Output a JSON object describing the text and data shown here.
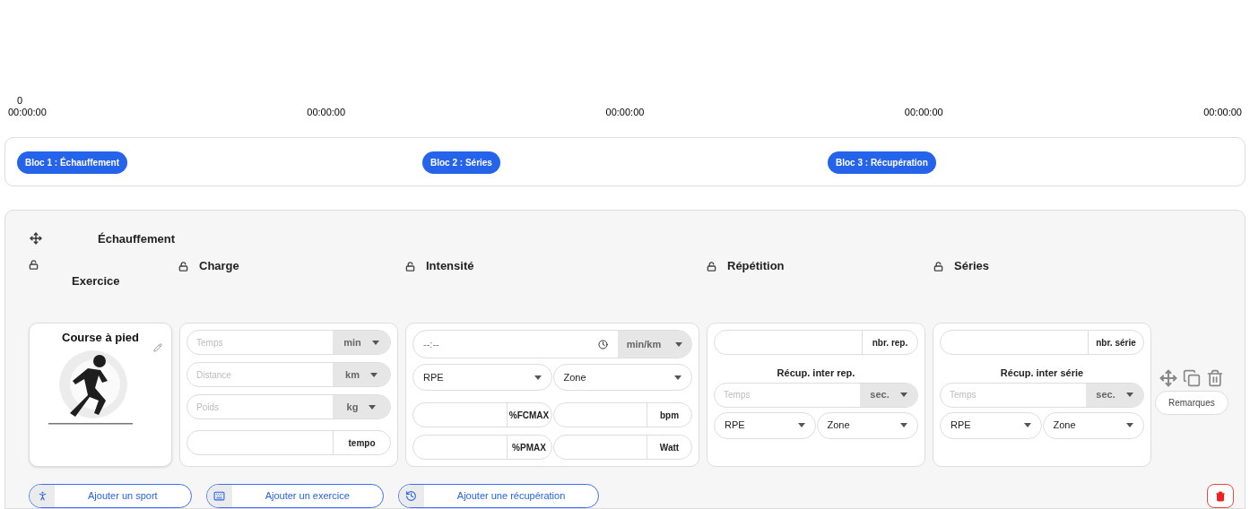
{
  "timeline": {
    "origin": "0",
    "marks": [
      "00:00:00",
      "00:00:00",
      "00:00:00",
      "00:00:00",
      "00:00:00"
    ]
  },
  "blocks": [
    {
      "label": "Bloc 1 : Échauffement"
    },
    {
      "label": "Bloc 2 : Séries"
    },
    {
      "label": "Bloc 3 : Récupération"
    }
  ],
  "section": {
    "title": "Échauffement",
    "exercise": {
      "header": "Exercice",
      "locked": false,
      "name": "Course à pied"
    },
    "charge": {
      "header": "Charge",
      "locked": false,
      "fields": [
        {
          "placeholder": "Temps",
          "unit": "min",
          "kind": "select"
        },
        {
          "placeholder": "Distance",
          "unit": "km",
          "kind": "select"
        },
        {
          "placeholder": "Poids",
          "unit": "kg",
          "kind": "select"
        },
        {
          "unit": "tempo",
          "kind": "static"
        }
      ]
    },
    "intensity": {
      "header": "Intensité",
      "locked": false,
      "pace": {
        "placeholder": "--:--",
        "unit": "min/km"
      },
      "selects": [
        {
          "value": "RPE"
        },
        {
          "value": "Zone"
        }
      ],
      "fields": [
        {
          "unit": "%FCMAX"
        },
        {
          "unit": "bpm"
        },
        {
          "unit": "%PMAX"
        },
        {
          "unit": "Watt"
        }
      ]
    },
    "repetition": {
      "header": "Répétition",
      "locked": false,
      "count_unit": "nbr. rep.",
      "recovery_title": "Récup. inter rep.",
      "recovery": {
        "placeholder": "Temps",
        "unit": "sec."
      },
      "selects": [
        {
          "value": "RPE"
        },
        {
          "value": "Zone"
        }
      ]
    },
    "series": {
      "header": "Séries",
      "locked": false,
      "count_unit": "nbr. série",
      "recovery_title": "Récup. inter série",
      "recovery": {
        "placeholder": "Temps",
        "unit": "sec."
      },
      "selects": [
        {
          "value": "RPE"
        },
        {
          "value": "Zone"
        }
      ]
    },
    "remarks_button": "Remarques"
  },
  "actions": [
    {
      "label": "Ajouter un sport",
      "kind": "sport"
    },
    {
      "label": "Ajouter un exercice",
      "kind": "exercise"
    },
    {
      "label": "Ajouter une récupération",
      "kind": "recovery"
    }
  ]
}
